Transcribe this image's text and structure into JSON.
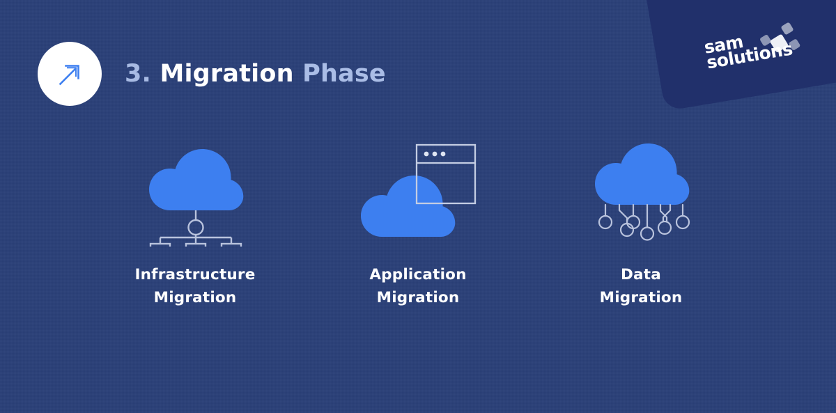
{
  "slide": {
    "background_color": "#2b4179",
    "corner_panel_color": "#21306b",
    "accent_blue": "#3d7ff0",
    "outline_color": "#b9c3dd",
    "white": "#ffffff"
  },
  "brand": {
    "logo_line1": "sam",
    "logo_line2": "solutions",
    "logo_icon_name": "sam-solutions-squares-mark"
  },
  "header": {
    "badge_icon_name": "arrow-up-right-icon",
    "step_number": "3.",
    "title_main": "Migration",
    "title_tail": "Phase",
    "full_title": "3. Migration Phase"
  },
  "cards": [
    {
      "id": "infrastructure-migration",
      "icon_name": "cloud-hierarchy-icon",
      "label_line1": "Infrastructure",
      "label_line2": "Migration"
    },
    {
      "id": "application-migration",
      "icon_name": "cloud-browser-window-icon",
      "label_line1": "Application",
      "label_line2": "Migration"
    },
    {
      "id": "data-migration",
      "icon_name": "cloud-circuit-nodes-icon",
      "label_line1": "Data",
      "label_line2": "Migration"
    }
  ]
}
